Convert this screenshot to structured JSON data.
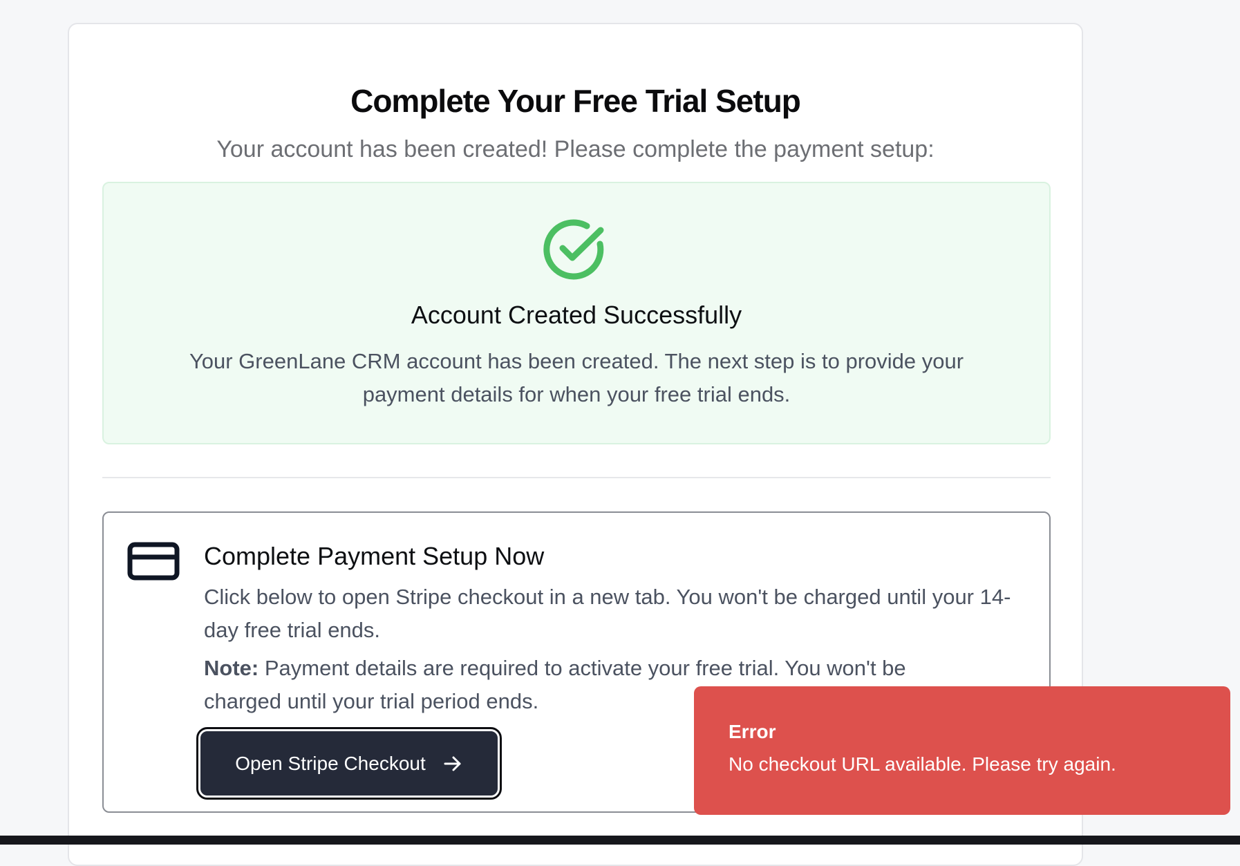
{
  "header": {
    "title": "Complete Your Free Trial Setup",
    "subtitle": "Your account has been created! Please complete the payment setup:"
  },
  "success": {
    "icon": "check-circle-icon",
    "title": "Account Created Successfully",
    "text": "Your GreenLane CRM account has been created. The next step is to provide your payment details for when your free trial ends.",
    "accent_color": "#4cbf62"
  },
  "payment": {
    "icon": "credit-card-icon",
    "title": "Complete Payment Setup Now",
    "text": "Click below to open Stripe checkout in a new tab. You won't be charged until your 14-day free trial ends.",
    "note_label": "Note:",
    "note_text": " Payment details are required to activate your free trial. You won't be charged until your trial period ends.",
    "button_label": "Open Stripe Checkout",
    "button_icon": "arrow-right-icon"
  },
  "toast": {
    "title": "Error",
    "message": "No checkout URL available. Please try again.",
    "color": "#dd514d"
  }
}
